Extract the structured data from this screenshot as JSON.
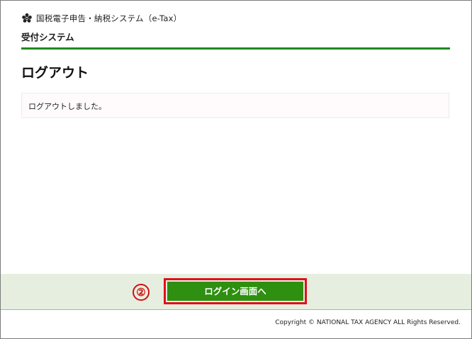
{
  "header": {
    "brand_text": "国税電子申告・納税システム（e-Tax）",
    "logo_icon": "government-crest-icon",
    "system_name": "受付システム"
  },
  "main": {
    "title": "ログアウト",
    "message": "ログアウトしました。"
  },
  "footer": {
    "step_marker": "②",
    "login_button_label": "ログイン画面へ",
    "copyright": "Copyright © NATIONAL TAX AGENCY ALL Rights Reserved."
  },
  "colors": {
    "accent_green": "#1f8a1f",
    "button_green": "#2e8f10",
    "footer_bg": "#e6eee0",
    "highlight_red": "#e0101a"
  }
}
